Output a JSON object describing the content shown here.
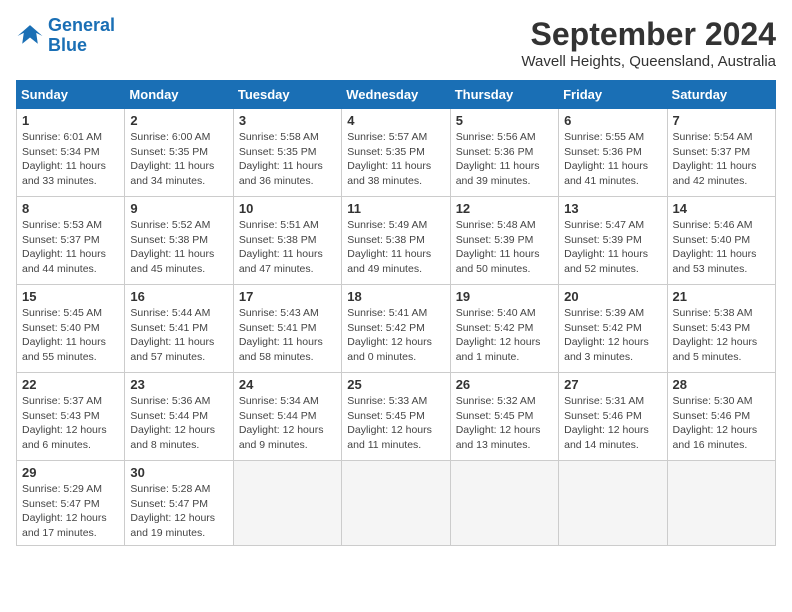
{
  "header": {
    "logo_line1": "General",
    "logo_line2": "Blue",
    "month": "September 2024",
    "location": "Wavell Heights, Queensland, Australia"
  },
  "days_of_week": [
    "Sunday",
    "Monday",
    "Tuesday",
    "Wednesday",
    "Thursday",
    "Friday",
    "Saturday"
  ],
  "weeks": [
    [
      {
        "num": "1",
        "sunrise": "6:01 AM",
        "sunset": "5:34 PM",
        "daylight": "11 hours and 33 minutes."
      },
      {
        "num": "2",
        "sunrise": "6:00 AM",
        "sunset": "5:35 PM",
        "daylight": "11 hours and 34 minutes."
      },
      {
        "num": "3",
        "sunrise": "5:58 AM",
        "sunset": "5:35 PM",
        "daylight": "11 hours and 36 minutes."
      },
      {
        "num": "4",
        "sunrise": "5:57 AM",
        "sunset": "5:35 PM",
        "daylight": "11 hours and 38 minutes."
      },
      {
        "num": "5",
        "sunrise": "5:56 AM",
        "sunset": "5:36 PM",
        "daylight": "11 hours and 39 minutes."
      },
      {
        "num": "6",
        "sunrise": "5:55 AM",
        "sunset": "5:36 PM",
        "daylight": "11 hours and 41 minutes."
      },
      {
        "num": "7",
        "sunrise": "5:54 AM",
        "sunset": "5:37 PM",
        "daylight": "11 hours and 42 minutes."
      }
    ],
    [
      {
        "num": "8",
        "sunrise": "5:53 AM",
        "sunset": "5:37 PM",
        "daylight": "11 hours and 44 minutes."
      },
      {
        "num": "9",
        "sunrise": "5:52 AM",
        "sunset": "5:38 PM",
        "daylight": "11 hours and 45 minutes."
      },
      {
        "num": "10",
        "sunrise": "5:51 AM",
        "sunset": "5:38 PM",
        "daylight": "11 hours and 47 minutes."
      },
      {
        "num": "11",
        "sunrise": "5:49 AM",
        "sunset": "5:38 PM",
        "daylight": "11 hours and 49 minutes."
      },
      {
        "num": "12",
        "sunrise": "5:48 AM",
        "sunset": "5:39 PM",
        "daylight": "11 hours and 50 minutes."
      },
      {
        "num": "13",
        "sunrise": "5:47 AM",
        "sunset": "5:39 PM",
        "daylight": "11 hours and 52 minutes."
      },
      {
        "num": "14",
        "sunrise": "5:46 AM",
        "sunset": "5:40 PM",
        "daylight": "11 hours and 53 minutes."
      }
    ],
    [
      {
        "num": "15",
        "sunrise": "5:45 AM",
        "sunset": "5:40 PM",
        "daylight": "11 hours and 55 minutes."
      },
      {
        "num": "16",
        "sunrise": "5:44 AM",
        "sunset": "5:41 PM",
        "daylight": "11 hours and 57 minutes."
      },
      {
        "num": "17",
        "sunrise": "5:43 AM",
        "sunset": "5:41 PM",
        "daylight": "11 hours and 58 minutes."
      },
      {
        "num": "18",
        "sunrise": "5:41 AM",
        "sunset": "5:42 PM",
        "daylight": "12 hours and 0 minutes."
      },
      {
        "num": "19",
        "sunrise": "5:40 AM",
        "sunset": "5:42 PM",
        "daylight": "12 hours and 1 minute."
      },
      {
        "num": "20",
        "sunrise": "5:39 AM",
        "sunset": "5:42 PM",
        "daylight": "12 hours and 3 minutes."
      },
      {
        "num": "21",
        "sunrise": "5:38 AM",
        "sunset": "5:43 PM",
        "daylight": "12 hours and 5 minutes."
      }
    ],
    [
      {
        "num": "22",
        "sunrise": "5:37 AM",
        "sunset": "5:43 PM",
        "daylight": "12 hours and 6 minutes."
      },
      {
        "num": "23",
        "sunrise": "5:36 AM",
        "sunset": "5:44 PM",
        "daylight": "12 hours and 8 minutes."
      },
      {
        "num": "24",
        "sunrise": "5:34 AM",
        "sunset": "5:44 PM",
        "daylight": "12 hours and 9 minutes."
      },
      {
        "num": "25",
        "sunrise": "5:33 AM",
        "sunset": "5:45 PM",
        "daylight": "12 hours and 11 minutes."
      },
      {
        "num": "26",
        "sunrise": "5:32 AM",
        "sunset": "5:45 PM",
        "daylight": "12 hours and 13 minutes."
      },
      {
        "num": "27",
        "sunrise": "5:31 AM",
        "sunset": "5:46 PM",
        "daylight": "12 hours and 14 minutes."
      },
      {
        "num": "28",
        "sunrise": "5:30 AM",
        "sunset": "5:46 PM",
        "daylight": "12 hours and 16 minutes."
      }
    ],
    [
      {
        "num": "29",
        "sunrise": "5:29 AM",
        "sunset": "5:47 PM",
        "daylight": "12 hours and 17 minutes."
      },
      {
        "num": "30",
        "sunrise": "5:28 AM",
        "sunset": "5:47 PM",
        "daylight": "12 hours and 19 minutes."
      },
      null,
      null,
      null,
      null,
      null
    ]
  ]
}
